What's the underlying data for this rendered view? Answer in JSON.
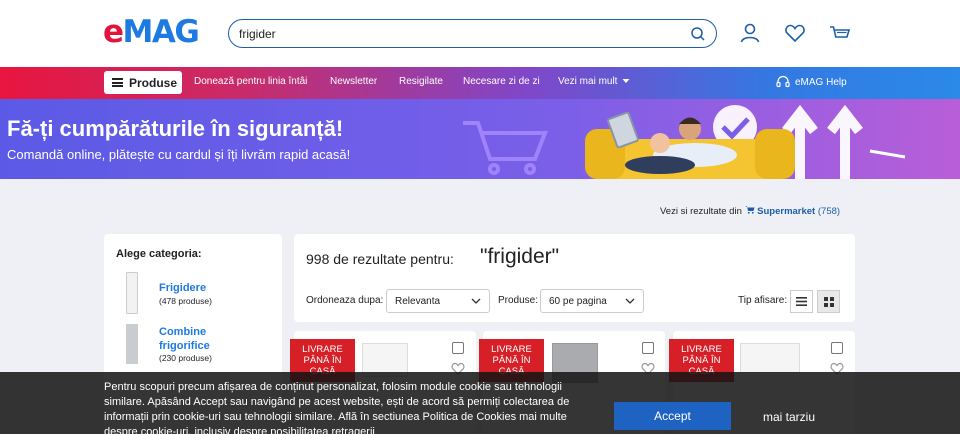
{
  "header": {
    "logo_e": "e",
    "logo_mag": "MAG",
    "search_value": "frigider"
  },
  "nav": {
    "products_label": "Produse",
    "links": [
      "Donează pentru linia întâi",
      "Newsletter",
      "Resigilate",
      "Necesare zi de zi",
      "Vezi mai mult"
    ],
    "help_label": "eMAG Help"
  },
  "banner": {
    "title": "Fă-ți cumpărăturile în siguranță!",
    "subtitle": "Comandă online, plătește cu cardul și îți livrăm rapid acasă!"
  },
  "supermarket": {
    "prefix": "Vezi si rezultate din",
    "name": "Supermarket",
    "count": "(758)"
  },
  "categories": {
    "title": "Alege categoria:",
    "items": [
      {
        "name": "Frigidere",
        "count": "(478 produse)"
      },
      {
        "name": "Combine frigorifice",
        "count": "(230 produse)"
      }
    ]
  },
  "results": {
    "count_text": "998 de rezultate pentru:",
    "query": "\"frigider\"",
    "sort_label": "Ordoneaza dupa:",
    "sort_value": "Relevanta",
    "per_page_label": "Produse:",
    "per_page_value": "60 pe pagina",
    "view_label": "Tip afisare:"
  },
  "products": [
    {
      "badge": "LIVRARE PÂNĂ ÎN CASĂ"
    },
    {
      "badge": "LIVRARE PÂNĂ ÎN CASĂ"
    },
    {
      "badge": "LIVRARE PÂNĂ ÎN CASĂ"
    }
  ],
  "cookie": {
    "text": "Pentru scopuri precum afișarea de conținut personalizat, folosim module cookie sau tehnologii similare. Apăsând Accept sau navigând pe acest website, ești de acord să permiți colectarea de informații prin cookie-uri sau tehnologii similare. Află în sectiunea Politica de Cookies mai multe despre cookie-uri, inclusiv despre posibilitatea retragerii",
    "accept_label": "Accept",
    "later_label": "mai tarziu"
  },
  "colors": {
    "brand_red": "#e2133d",
    "brand_blue": "#1d7ae0",
    "accept_blue": "#1f63c2",
    "badge_red": "#d61f26"
  },
  "icons": [
    "search-icon",
    "user-icon",
    "heart-icon",
    "cart-icon",
    "menu-icon",
    "headset-icon",
    "chevron-down-icon",
    "list-view-icon",
    "grid-view-icon"
  ]
}
